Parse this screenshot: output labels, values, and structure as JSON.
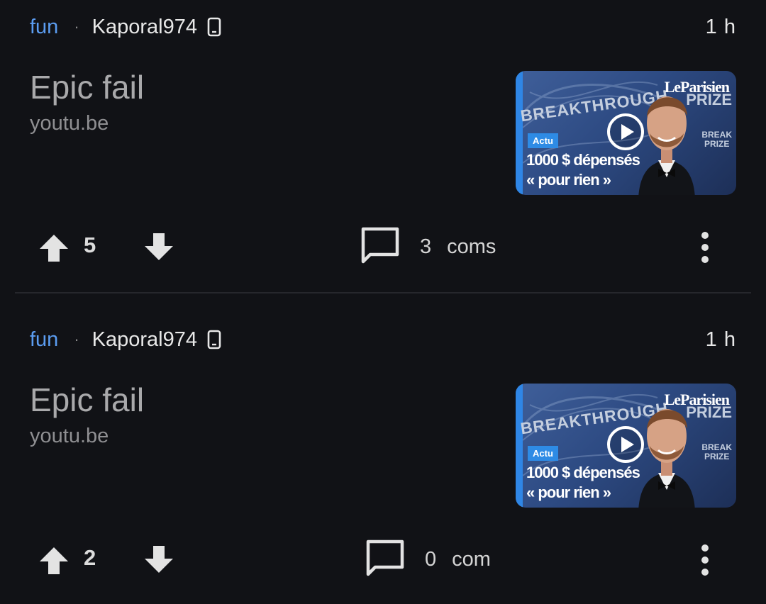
{
  "posts": [
    {
      "community": "fun",
      "separator": "·",
      "author": "Kaporal974",
      "device_icon": "phone-icon",
      "time": "1 h",
      "title": "Epic fail",
      "domain": "youtu.be",
      "thumbnail": {
        "headline_line1": "1000 $ dépensés",
        "headline_line2": "« pour rien »",
        "tag": "Actu",
        "logo": "LeParisien",
        "backdrop_top": "BREAKTHROUGH",
        "backdrop_right": "PRIZE"
      },
      "score": "5",
      "comment_count": "3",
      "comment_label": "coms"
    },
    {
      "community": "fun",
      "separator": "·",
      "author": "Kaporal974",
      "device_icon": "phone-icon",
      "time": "1 h",
      "title": "Epic fail",
      "domain": "youtu.be",
      "thumbnail": {
        "headline_line1": "1000 $ dépensés",
        "headline_line2": "« pour rien »",
        "tag": "Actu",
        "logo": "LeParisien",
        "backdrop_top": "BREAKTHROUGH",
        "backdrop_right": "PRIZE"
      },
      "score": "2",
      "comment_count": "0",
      "comment_label": "com"
    }
  ],
  "colors": {
    "background": "#111216",
    "community": "#5b9cf0",
    "title": "#a9a9ab",
    "thumb_accent": "#2e8be5"
  }
}
